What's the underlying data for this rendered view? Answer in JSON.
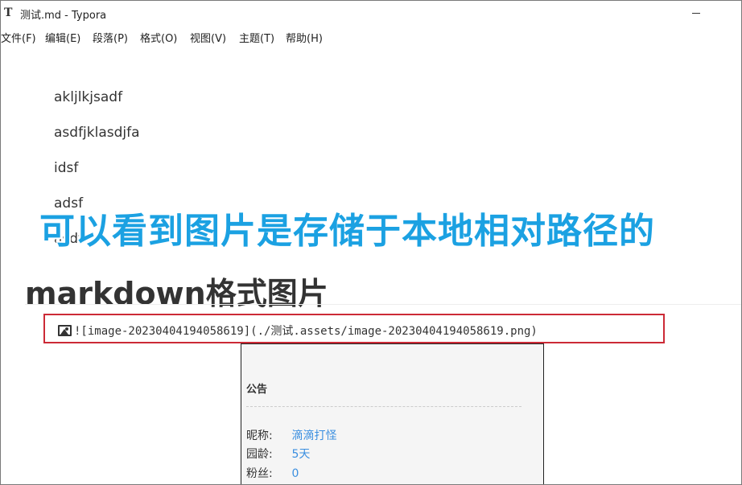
{
  "window": {
    "title": "测试.md - Typora",
    "app_icon_glyph": "T"
  },
  "menu": {
    "items": [
      {
        "label": "文件(F)"
      },
      {
        "label": "编辑(E)"
      },
      {
        "label": "段落(P)"
      },
      {
        "label": "格式(O)"
      },
      {
        "label": "视图(V)"
      },
      {
        "label": "主题(T)"
      },
      {
        "label": "帮助(H)"
      }
    ]
  },
  "document": {
    "paragraphs": [
      "akljlkjsadf",
      "asdfjklasdjfa",
      "idsf",
      "adsf",
      "asdf"
    ],
    "annotation_overlay": "可以看到图片是存储于本地相对路径的",
    "heading": "markdown格式图片",
    "image_markdown_source": "![image-20230404194058619](./测试.assets/image-20230404194058619.png)"
  },
  "image_preview": {
    "notice_title": "公告",
    "rows": [
      {
        "label": "昵称:",
        "value": "滴滴打怪"
      },
      {
        "label": "园龄:",
        "value": "5天"
      },
      {
        "label": "粉丝:",
        "value": "0"
      }
    ]
  },
  "colors": {
    "overlay_text": "#1ba1e2",
    "highlight_border": "#cc2a36",
    "link_value": "#3b8fe0"
  },
  "icons": {
    "app": "typora-icon",
    "image_source": "image-icon"
  }
}
